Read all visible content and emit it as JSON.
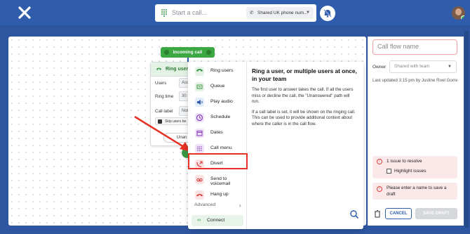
{
  "topbar": {
    "call_placeholder": "Start a call...",
    "number_selector": "Shared UK phone num...",
    "colors": {
      "bar": "#2f5dab",
      "accent_green": "#3a9a45",
      "error_red": "#e53225"
    }
  },
  "canvas": {
    "incoming_call_label": "Incoming call",
    "ring_node": {
      "title": "Ring users",
      "rows": [
        {
          "label": "Users",
          "value": "Ass"
        },
        {
          "label": "Ring time",
          "value": "30"
        },
        {
          "label": "Call label",
          "value": "Non"
        }
      ],
      "skip_label": "Skip users be"
    },
    "unanswered_label": "Unan"
  },
  "picker": {
    "items": [
      {
        "label": "Ring users",
        "icon": "phone-ring-icon",
        "color": "#e4f2e5",
        "fg": "#3a9a45"
      },
      {
        "label": "Queue",
        "icon": "queue-icon",
        "color": "#e4f2e5",
        "fg": "#3a9a45"
      },
      {
        "label": "Play audio",
        "icon": "speaker-icon",
        "color": "#e3ecfa",
        "fg": "#2f5dab"
      },
      {
        "label": "Schedule",
        "icon": "clock-icon",
        "color": "#efe3f7",
        "fg": "#8a3fbf"
      },
      {
        "label": "Dates",
        "icon": "calendar-icon",
        "color": "#efe3f7",
        "fg": "#8a3fbf"
      },
      {
        "label": "Call menu",
        "icon": "keypad-icon",
        "color": "#efe3f7",
        "fg": "#8a3fbf"
      },
      {
        "label": "Divert",
        "icon": "divert-icon",
        "color": "#fbe3e3",
        "fg": "#d43b3b"
      },
      {
        "label": "Send to voicemail",
        "icon": "voicemail-icon",
        "color": "#fbe3e3",
        "fg": "#d43b3b"
      },
      {
        "label": "Hang up",
        "icon": "hangup-icon",
        "color": "#fbe3e3",
        "fg": "#d43b3b"
      }
    ],
    "advanced_label": "Advanced",
    "connect_label": "Connect",
    "description": {
      "heading": "Ring a user, or multiple users at once, in your team",
      "p1": "The first user to answer takes the call. If all the users miss or decline the call, the \"Unanswered\" path will run.",
      "p2": "If a call label is set, it will be shown on the ringing call. This can be used to provide additional context about where the caller is in the call flow."
    }
  },
  "sidebar": {
    "name_placeholder": "Call flow name",
    "owner_label": "Owner",
    "owner_value": "Shared with team",
    "last_updated": "Last updated 3:15 pm by Justine Roel Gorre",
    "issue_text": "1 issue to resolve",
    "highlight_label": "Highlight issues",
    "error_text": "Please enter a name to save a draft",
    "cancel_label": "CANCEL",
    "save_label": "SAVE DRAFT"
  }
}
